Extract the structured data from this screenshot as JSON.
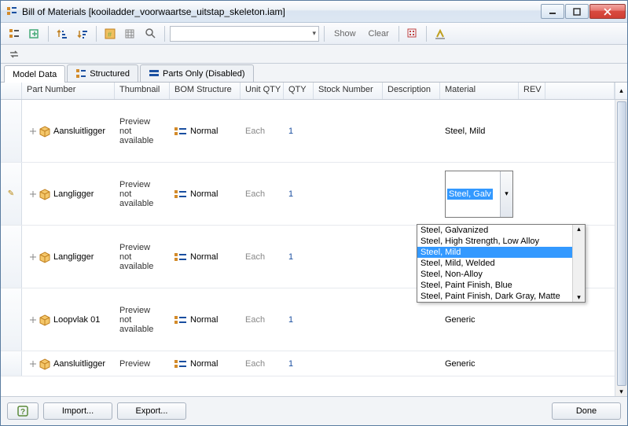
{
  "window": {
    "title": "Bill of Materials [kooiladder_voorwaartse_uitstap_skeleton.iam]"
  },
  "toolbar": {
    "show": "Show",
    "clear": "Clear"
  },
  "tabs": {
    "model_data": "Model Data",
    "structured": "Structured",
    "parts_only": "Parts Only (Disabled)"
  },
  "columns": {
    "part_number": "Part Number",
    "thumbnail": "Thumbnail",
    "bom_structure": "BOM Structure",
    "unit_qty": "Unit QTY",
    "qty": "QTY",
    "stock_number": "Stock Number",
    "description": "Description",
    "material": "Material",
    "rev": "REV"
  },
  "rows": [
    {
      "part": "Aansluitligger",
      "thumb": "Preview not available",
      "bom": "Normal",
      "unit": "Each",
      "qty": "1",
      "mat": "Steel, Mild",
      "editing": false
    },
    {
      "part": "Langligger",
      "thumb": "Preview not available",
      "bom": "Normal",
      "unit": "Each",
      "qty": "1",
      "mat": "Steel, Galv",
      "editing": true
    },
    {
      "part": "Langligger",
      "thumb": "Preview not available",
      "bom": "Normal",
      "unit": "Each",
      "qty": "1",
      "mat": "Steel, Mild",
      "editing": false
    },
    {
      "part": "Loopvlak 01",
      "thumb": "Preview not available",
      "bom": "Normal",
      "unit": "Each",
      "qty": "1",
      "mat": "Generic",
      "editing": false
    },
    {
      "part": "Aansluitligger",
      "thumb": "Preview",
      "bom": "Normal",
      "unit": "Each",
      "qty": "1",
      "mat": "Generic",
      "editing": false
    }
  ],
  "dropdown": {
    "options": [
      "Steel, Galvanized",
      "Steel, High Strength, Low Alloy",
      "Steel, Mild",
      "Steel, Mild, Welded",
      "Steel, Non-Alloy",
      "Steel, Paint Finish, Blue",
      "Steel, Paint Finish, Dark Gray, Matte"
    ],
    "selected": "Steel, Mild"
  },
  "footer": {
    "import": "Import...",
    "export": "Export...",
    "done": "Done"
  }
}
